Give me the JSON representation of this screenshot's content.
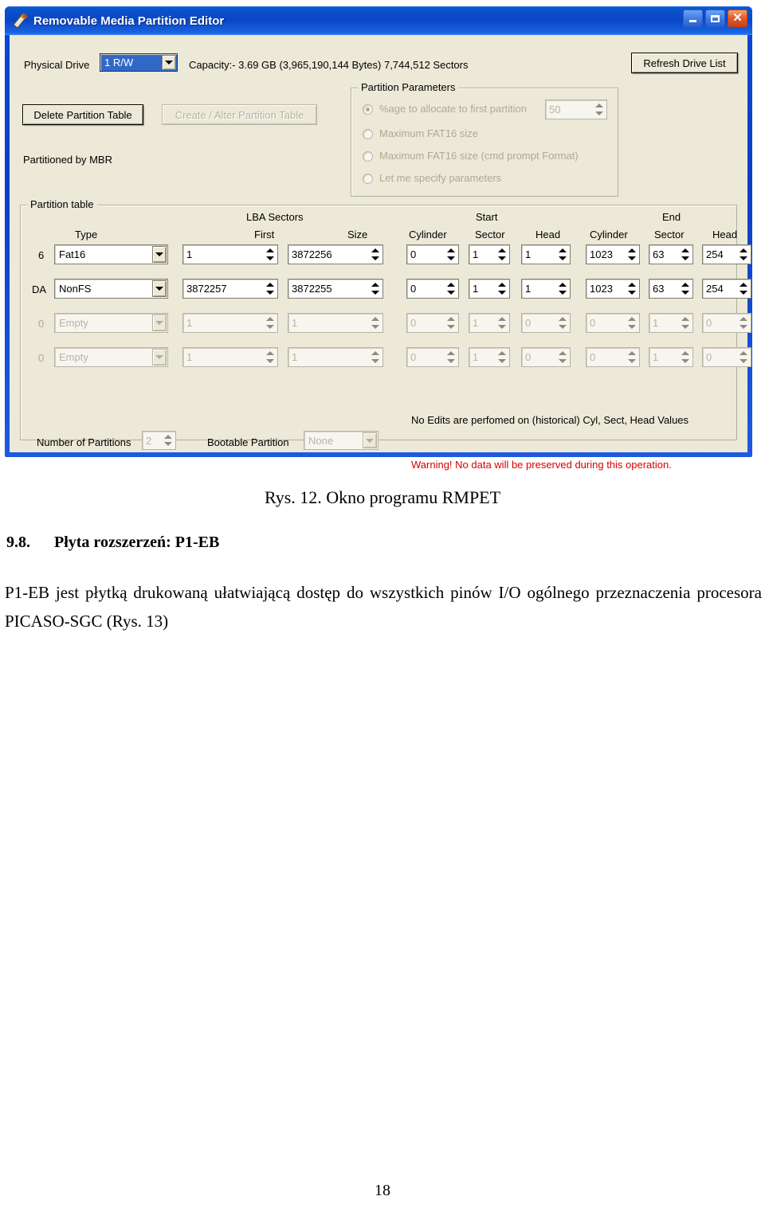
{
  "window": {
    "title": "Removable Media Partition Editor",
    "icon": "app-icon",
    "buttons": {
      "minimize": "_",
      "maximize": "□",
      "close": "✕"
    }
  },
  "toolbar": {
    "physical_drive_label": "Physical Drive",
    "physical_drive_value": "1 R/W",
    "capacity_text": "Capacity:- 3.69 GB (3,965,190,144 Bytes) 7,744,512 Sectors",
    "refresh_label": "Refresh Drive List"
  },
  "actions": {
    "delete_label": "Delete Partition Table",
    "create_label": "Create / Alter Partition Table",
    "partitioned_by": "Partitioned by MBR"
  },
  "partition_parameters": {
    "group_title": "Partition Parameters",
    "options": [
      {
        "label": "%age to allocate to first partition",
        "selected": true
      },
      {
        "label": "Maximum FAT16 size",
        "selected": false
      },
      {
        "label": "Maximum FAT16 size (cmd prompt Format)",
        "selected": false
      },
      {
        "label": "Let me specify parameters",
        "selected": false
      }
    ],
    "percent_value": "50"
  },
  "partition_table": {
    "group_title": "Partition table",
    "headers": {
      "type": "Type",
      "lba_sectors": "LBA Sectors",
      "first": "First",
      "size": "Size",
      "start": "Start",
      "end": "End",
      "cylinder": "Cylinder",
      "sector": "Sector",
      "head": "Head"
    },
    "rows": [
      {
        "id": "6",
        "type": "Fat16",
        "first": "1",
        "size": "3872256",
        "start_cylinder": "0",
        "start_sector": "1",
        "start_head": "1",
        "end_cylinder": "1023",
        "end_sector": "63",
        "end_head": "254",
        "enabled": true
      },
      {
        "id": "DA",
        "type": "NonFS",
        "first": "3872257",
        "size": "3872255",
        "start_cylinder": "0",
        "start_sector": "1",
        "start_head": "1",
        "end_cylinder": "1023",
        "end_sector": "63",
        "end_head": "254",
        "enabled": true
      },
      {
        "id": "0",
        "type": "Empty",
        "first": "1",
        "size": "1",
        "start_cylinder": "0",
        "start_sector": "1",
        "start_head": "0",
        "end_cylinder": "0",
        "end_sector": "1",
        "end_head": "0",
        "enabled": false
      },
      {
        "id": "0",
        "type": "Empty",
        "first": "1",
        "size": "1",
        "start_cylinder": "0",
        "start_sector": "1",
        "start_head": "0",
        "end_cylinder": "0",
        "end_sector": "1",
        "end_head": "0",
        "enabled": false
      }
    ],
    "footer": {
      "number_label": "Number of Partitions",
      "number_value": "2",
      "bootable_label": "Bootable Partition",
      "bootable_value": "None",
      "note": "No Edits are perfomed on (historical) Cyl, Sect, Head Values",
      "warning": "Warning! No data will be preserved during this operation."
    }
  },
  "document": {
    "figure_caption": "Rys. 12. Okno programu RMPET",
    "section_number": "9.8.",
    "section_title": "Płyta rozszerzeń: P1-EB",
    "body": "P1-EB jest płytką drukowaną ułatwiającą dostęp do wszystkich pinów I/O ogólnego przeznaczenia procesora PICASO-SGC (Rys. 13)",
    "page_number": "18"
  },
  "colors": {
    "title_bar": "#0a46c6",
    "client": "#ece9d8",
    "warning": "#d80000",
    "selection": "#3168c8"
  }
}
